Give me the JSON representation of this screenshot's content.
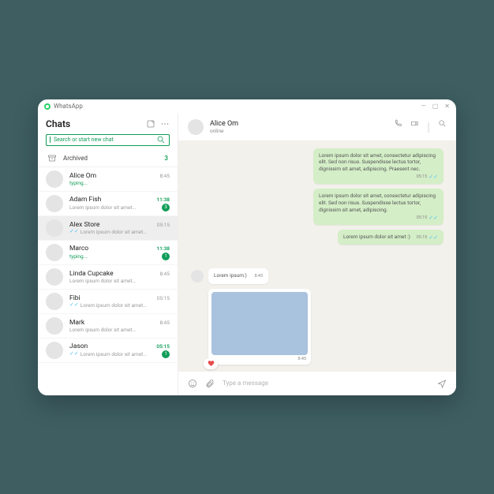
{
  "app": {
    "name": "WhatsApp"
  },
  "windowControls": {
    "minimize": "—",
    "maximize": "▢",
    "close": "✕"
  },
  "sidebar": {
    "title": "Chats",
    "search": {
      "placeholder": "Search or start new chat"
    },
    "archived": {
      "label": "Archived",
      "count": "3"
    }
  },
  "chats": [
    {
      "name": "Alice Om",
      "time": "8:45",
      "preview": "typing...",
      "typing": true,
      "unread": 0,
      "checks": false,
      "active": false
    },
    {
      "name": "Adam Fish",
      "time": "11:38",
      "preview": "Lorem ipsum dolor sit amet...",
      "typing": false,
      "unread": 3,
      "checks": false,
      "active": false
    },
    {
      "name": "Alex Store",
      "time": "05:15",
      "preview": "Lorem ipsum dolor sit amet...",
      "typing": false,
      "unread": 0,
      "checks": true,
      "active": true
    },
    {
      "name": "Marco",
      "time": "11:38",
      "preview": "typing...",
      "typing": true,
      "unread": 1,
      "checks": false,
      "active": false
    },
    {
      "name": "Linda Cupcake",
      "time": "8:45",
      "preview": "Lorem ipsum dolor sit amet...",
      "typing": false,
      "unread": 0,
      "checks": false,
      "active": false
    },
    {
      "name": "Fibi",
      "time": "05:15",
      "preview": "Lorem ipsum dolor sit amet...",
      "typing": false,
      "unread": 0,
      "checks": true,
      "active": false
    },
    {
      "name": "Mark",
      "time": "8:45",
      "preview": "Lorem ipsum dolor sit amet...",
      "typing": false,
      "unread": 0,
      "checks": false,
      "active": false
    },
    {
      "name": "Jason",
      "time": "05:15",
      "preview": "Lorem ipsum dolor sit amet...",
      "typing": false,
      "unread": 1,
      "checks": true,
      "active": false
    }
  ],
  "conversation": {
    "name": "Alice Om",
    "status": "online",
    "messages": {
      "out1": {
        "text": "Lorem ipsum dolor sit amet, consectetur adipiscing elit. Sed non risus. Suspendisse lectus tortor, dignissim sit amet, adipiscing. Praesent nec.",
        "time": "05:15"
      },
      "out2": {
        "text": "Lorem ipsum dolor sit amet, consectetur adipiscing elit. Sed non risus. Suspendisse lectus tortor, dignissim sit amet, adipiscing.",
        "time": "05:15"
      },
      "out3": {
        "text": "Lorem ipsum dolor sit amet :)",
        "time": "05:15"
      },
      "in1": {
        "text": "Lorem ipsum:)",
        "time": "8:45"
      },
      "img": {
        "time": "8:45"
      }
    }
  },
  "composer": {
    "placeholder": "Type a message"
  }
}
